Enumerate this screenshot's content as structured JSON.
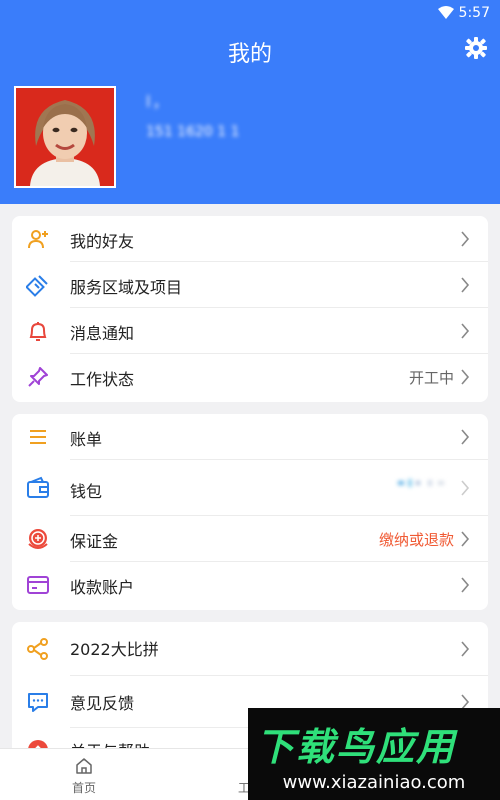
{
  "status_bar": {
    "time": "5:57"
  },
  "header": {
    "title": "我的"
  },
  "profile": {
    "name": "l，",
    "phone": "151 1620 1 1"
  },
  "group1": [
    {
      "label": "我的好友",
      "value": "",
      "icon": "add-friend-icon"
    },
    {
      "label": "服务区域及项目",
      "value": "",
      "icon": "service-area-icon"
    },
    {
      "label": "消息通知",
      "value": "",
      "icon": "bell-icon"
    },
    {
      "label": "工作状态",
      "value": "开工中",
      "icon": "pin-icon"
    }
  ],
  "group2": [
    {
      "label": "账单",
      "value": "",
      "icon": "bill-icon"
    },
    {
      "label": "钱包",
      "value": "",
      "icon": "wallet-icon"
    },
    {
      "label": "保证金",
      "value": "缴纳或退款",
      "icon": "deposit-icon"
    },
    {
      "label": "收款账户",
      "value": "",
      "icon": "card-icon"
    }
  ],
  "group3": [
    {
      "label": "2022大比拼",
      "value": "",
      "icon": "share-icon"
    },
    {
      "label": "意见反馈",
      "value": "",
      "icon": "feedback-icon"
    },
    {
      "label": "关于与帮助",
      "value": "",
      "icon": "help-icon"
    }
  ],
  "tabbar": {
    "home": "首页",
    "work": "工"
  },
  "watermark": {
    "brand": "下载鸟应用",
    "url": "www.xiazainiao.com"
  },
  "colors": {
    "primary": "#3a7dfa",
    "accent_orange": "#f05a34"
  }
}
